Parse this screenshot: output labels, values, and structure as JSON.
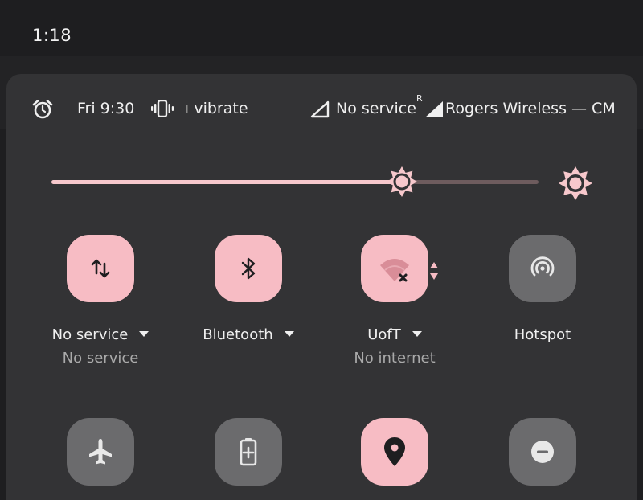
{
  "statusbar": {
    "time": "1:18"
  },
  "info_row": {
    "alarm_time": "Fri 9:30",
    "ringer_mode": "vibrate",
    "sim1_status": "No service",
    "roaming_indicator": "R",
    "carrier": "Rogers Wireless — CMCC"
  },
  "brightness": {
    "level": 0.72
  },
  "tiles": [
    {
      "label": "No service",
      "sub": "No service",
      "state": "on",
      "icon": "mobile-data-icon",
      "has_caret": true
    },
    {
      "label": "Bluetooth",
      "sub": "",
      "state": "on",
      "icon": "bluetooth-icon",
      "has_caret": true
    },
    {
      "label": "UofT",
      "sub": "No internet",
      "state": "on",
      "icon": "wifi-no-internet-icon",
      "has_caret": true
    },
    {
      "label": "Hotspot",
      "sub": "",
      "state": "off",
      "icon": "hotspot-icon",
      "has_caret": false
    },
    {
      "label": "",
      "sub": "",
      "state": "off",
      "icon": "airplane-icon",
      "has_caret": false
    },
    {
      "label": "",
      "sub": "",
      "state": "off",
      "icon": "battery-saver-icon",
      "has_caret": false
    },
    {
      "label": "",
      "sub": "",
      "state": "on",
      "icon": "location-icon",
      "has_caret": false
    },
    {
      "label": "",
      "sub": "",
      "state": "off",
      "icon": "do-not-disturb-icon",
      "has_caret": false
    }
  ],
  "colors": {
    "accent": "#f7bcc4",
    "tile_off": "#6b6b6d",
    "panel": "#333335",
    "icon_on": "#1e1e20",
    "icon_off": "#e8e8e8"
  }
}
